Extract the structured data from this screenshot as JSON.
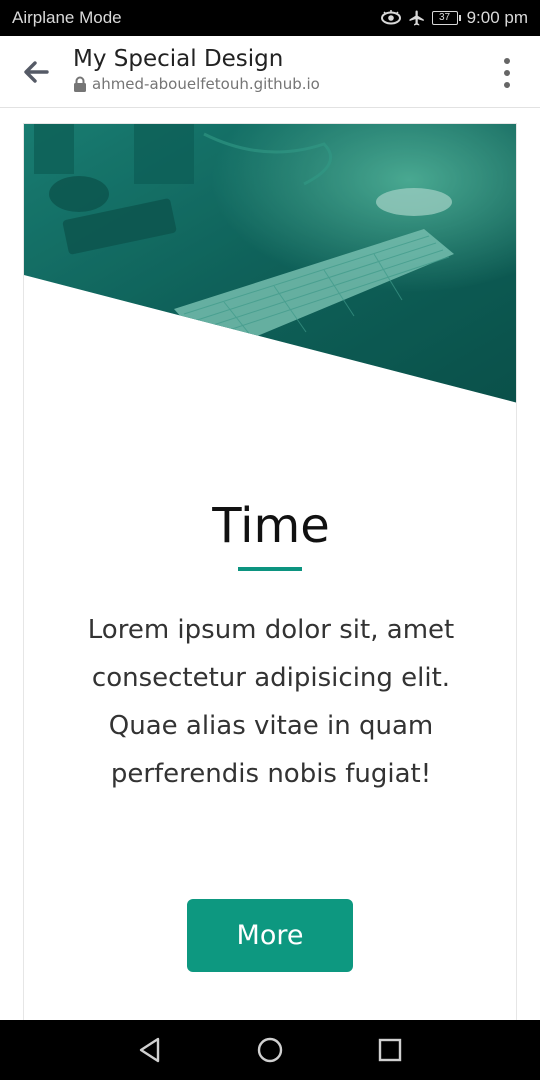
{
  "status_bar": {
    "carrier": "Airplane Mode",
    "battery": "37",
    "time": "9:00 pm",
    "icons": [
      "eye-icon",
      "airplane-icon",
      "battery-icon"
    ]
  },
  "app_bar": {
    "title": "My Special Design",
    "url": "ahmed-abouelfetouh.github.io",
    "icons": [
      "back-arrow-icon",
      "lock-icon",
      "more-vert-icon"
    ]
  },
  "card": {
    "title": "Time",
    "text": "Lorem ipsum dolor sit, amet consectetur adipisicing elit. Quae alias vitae in quam perferendis nobis fugiat!",
    "button_label": "More"
  },
  "colors": {
    "accent": "#0d9880",
    "hero_overlay": "#0b6e63"
  },
  "nav_bar": {
    "icons": [
      "back-triangle-icon",
      "home-circle-icon",
      "recents-square-icon"
    ]
  }
}
